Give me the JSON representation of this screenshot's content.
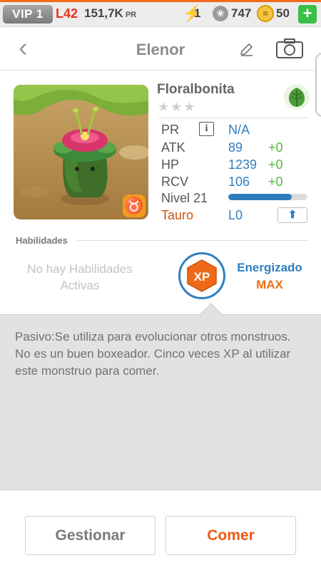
{
  "topbar": {
    "vip": "VIP 1",
    "level": "L42",
    "power": "151,7K",
    "power_unit": "PR",
    "energy": "1",
    "paws": "747",
    "coins": "50",
    "add_label": "+"
  },
  "header": {
    "title": "Elenor"
  },
  "monster": {
    "species": "Floralbonita",
    "stars": "★★★",
    "element_icon": "leaf-icon",
    "stats": {
      "pr_label": "PR",
      "pr_value": "N/A",
      "atk_label": "ATK",
      "atk_value": "89",
      "atk_bonus": "+0",
      "hp_label": "HP",
      "hp_value": "1239",
      "hp_bonus": "+0",
      "rcv_label": "RCV",
      "rcv_value": "106",
      "rcv_bonus": "+0",
      "level_label": "Nivel 21",
      "level_progress": 0.8,
      "sign_label": "Tauro",
      "sign_level": "L0"
    }
  },
  "abilities": {
    "heading": "Habilidades",
    "none_text": "No hay Habilidades Activas",
    "xp_badge_label": "XP",
    "status_label": "Energizado",
    "status_value": "MAX"
  },
  "description": {
    "text": "Pasivo:Se utiliza para evolucionar otros monstruos. No es un buen boxeador. Cinco veces XP al utilizar este monstruo para comer."
  },
  "actions": {
    "manage_label": "Gestionar",
    "eat_label": "Comer"
  },
  "colors": {
    "accent_blue": "#2f7fc1",
    "accent_orange": "#ee6e16",
    "bonus_green": "#53b83f"
  }
}
